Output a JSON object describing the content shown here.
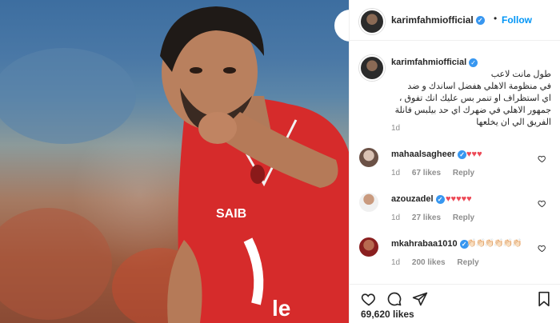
{
  "post": {
    "author": "karimfahmiofficial",
    "follow_label": "Follow",
    "dot": "•",
    "caption": "طول مانت لاعب\nفي منظومة الاهلي هفضل اساندك و ضد\nاي استظراف او تنمر بس عليك انك تفوق ،\nجمهور الاهلي في ضهرك اي حد بيلبس فانلة\nالفريق الي ان يخلعها",
    "caption_time": "1d",
    "likes_total": "69,620 likes"
  },
  "comments": [
    {
      "user": "mahaalsagheer",
      "text": "♥♥♥",
      "time": "1d",
      "likes": "67 likes",
      "reply": "Reply",
      "text_color": "#ed4956"
    },
    {
      "user": "azouzadel",
      "text": "♥♥♥♥♥",
      "time": "1d",
      "likes": "27 likes",
      "reply": "Reply",
      "text_color": "#ed4956"
    },
    {
      "user": "mkahrabaa1010",
      "text": "👏🏻👏🏻👏🏻👏🏻👏🏻👏🏻",
      "time": "1d",
      "likes": "200 likes",
      "reply": "Reply",
      "text_color": "#e6c9a8"
    }
  ],
  "colors": {
    "accent": "#0095f6",
    "verified": "#3897f0",
    "jersey": "#d62b2b"
  },
  "icons": [
    "heart-icon",
    "comment-icon",
    "share-icon",
    "bookmark-icon",
    "verified-icon",
    "small-heart-icon"
  ]
}
